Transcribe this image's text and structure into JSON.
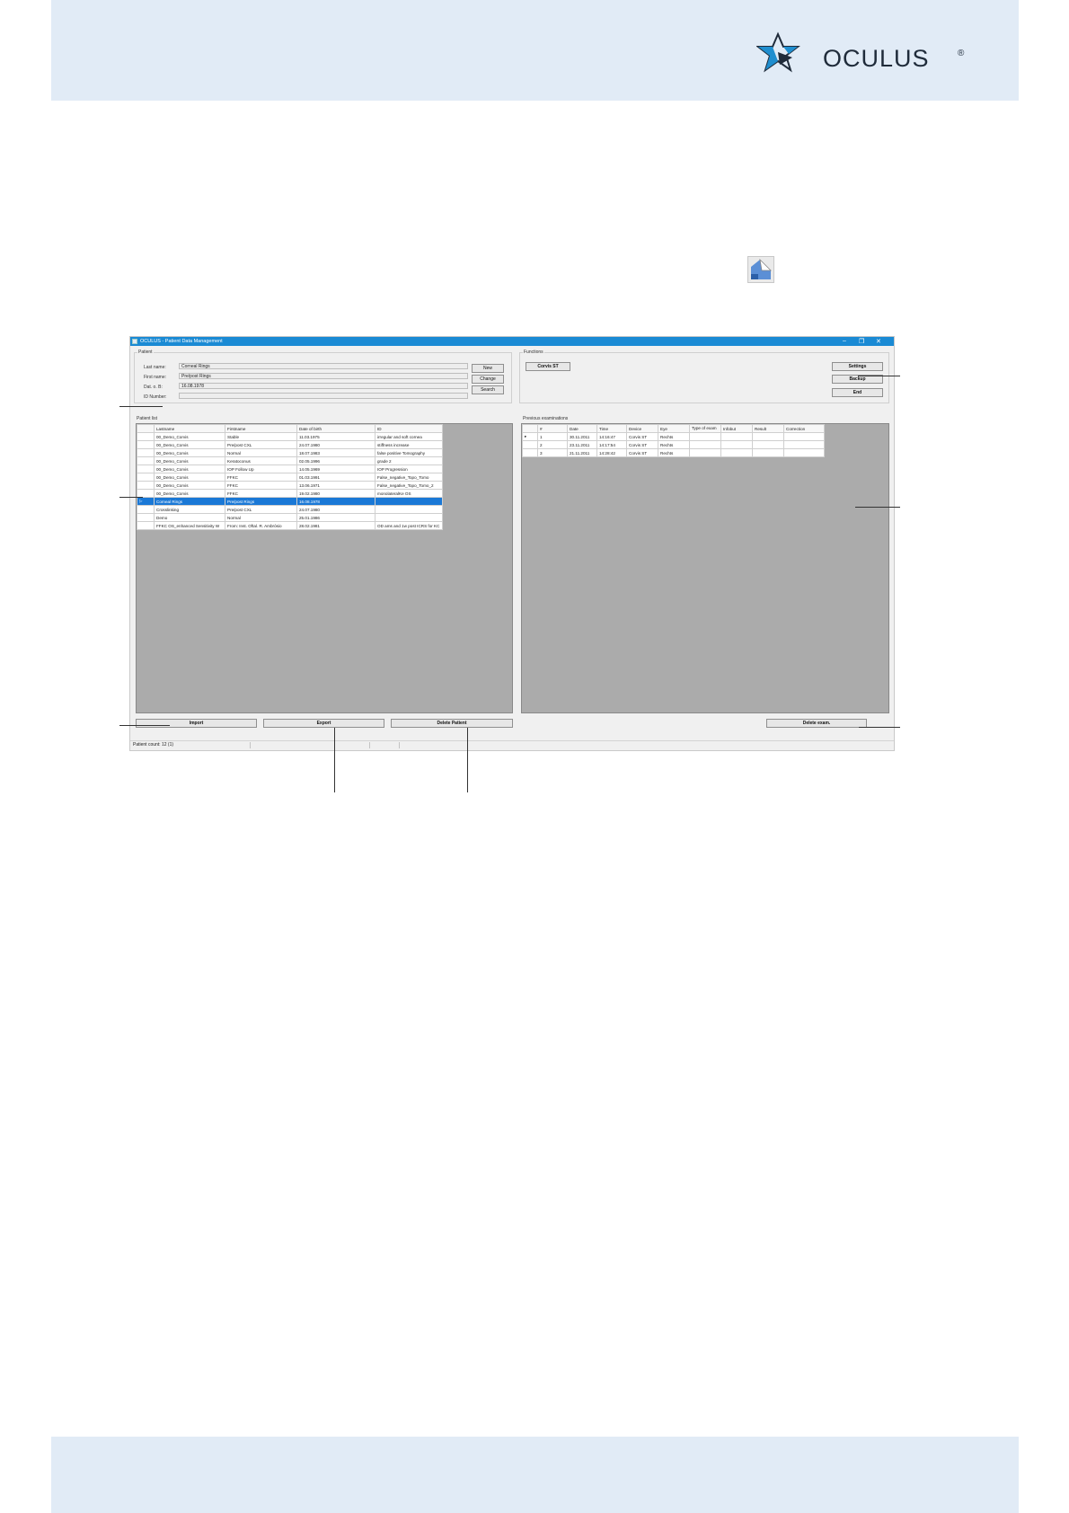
{
  "brand": {
    "name": "OCULUS",
    "reg": "®",
    "color": "#1f8ecf",
    "dark": "#1f2b3a"
  },
  "window": {
    "title": "OCULUS - Patient Data Management",
    "controls": [
      "–",
      "❐",
      "✕"
    ],
    "patient_group": {
      "label": "Patient",
      "fields": [
        {
          "label": "Last name:",
          "value": "Corneal Rings"
        },
        {
          "label": "First name:",
          "value": "Pre/post Rings"
        },
        {
          "label": "Dat. o. B:",
          "value": "16.08.1978"
        },
        {
          "label": "ID Number:",
          "value": ""
        }
      ],
      "buttons": [
        "New",
        "Change",
        "Search"
      ]
    },
    "functions_group": {
      "label": "Functions",
      "device_button": "Corvis ST",
      "buttons": [
        "Settings",
        "Backup",
        "End"
      ]
    },
    "patient_list": {
      "label": "Patient list",
      "columns": [
        "",
        "Lastname",
        "Firstname",
        "Date of birth",
        "ID"
      ],
      "rows": [
        [
          "",
          "00_Demo_Corvis",
          "Stable",
          "11.03.1975",
          "irregular and soft cornea"
        ],
        [
          "",
          "00_Demo_Corvis",
          "Pre/post CXL",
          "24.07.1980",
          "stiffness increase"
        ],
        [
          "",
          "00_Demo_Corvis",
          "Normal",
          "18.07.1983",
          "false positive Tomography"
        ],
        [
          "",
          "00_Demo_Corvis",
          "Keratoconus",
          "02.05.1996",
          "grade 2"
        ],
        [
          "",
          "00_Demo_Corvis",
          "IOP Follow Up",
          "14.05.1969",
          "IOP Progression"
        ],
        [
          "",
          "00_Demo_Corvis",
          "FFKC",
          "01.03.1991",
          "False_negative_Topo_Tomo"
        ],
        [
          "",
          "00_Demo_Corvis",
          "FFKC",
          "13.06.1971",
          "False_negative_Topo_Tomo_2"
        ],
        [
          "",
          "00_Demo_Corvis",
          "FFKC",
          "19.02.1980",
          "monolateralKe OS"
        ],
        [
          "▷",
          "Corneal Rings",
          "Pre/post Rings",
          "16.08.1978",
          ""
        ],
        [
          "",
          "Crosslinking",
          "Pre/post CXL",
          "24.07.1980",
          ""
        ],
        [
          "",
          "Demo",
          "Normal",
          "25.01.1986",
          ""
        ],
        [
          "",
          "FFKC OS_enhanced Sensitivity W",
          "From: Inst. Oftal. R. Ambrósio",
          "28.02.1981",
          "OD ams and 1w post ICRS for KC"
        ]
      ],
      "selected_index": 8
    },
    "previous_exams": {
      "label": "Previous examinations",
      "columns": [
        "",
        "#",
        "Date",
        "Time",
        "Device",
        "Eye",
        "Type of exam",
        "Infobut",
        "Result",
        "Correction"
      ],
      "rows": [
        [
          "▸",
          "1",
          "30.11.2011",
          "14:16:47",
          "Corvis ST",
          "Rechts",
          "",
          "",
          "",
          ""
        ],
        [
          "",
          "2",
          "23.11.2011",
          "14:17:54",
          "Corvis ST",
          "Rechts",
          "",
          "",
          "",
          ""
        ],
        [
          "",
          "3",
          "21.11.2011",
          "14:28:42",
          "Corvis ST",
          "Rechts",
          "",
          "",
          "",
          ""
        ]
      ]
    },
    "bottom_buttons": [
      "Import",
      "Export",
      "Delete Patient"
    ],
    "delete_exam": "Delete exam.",
    "status": "Patient count: 12 (1)"
  }
}
